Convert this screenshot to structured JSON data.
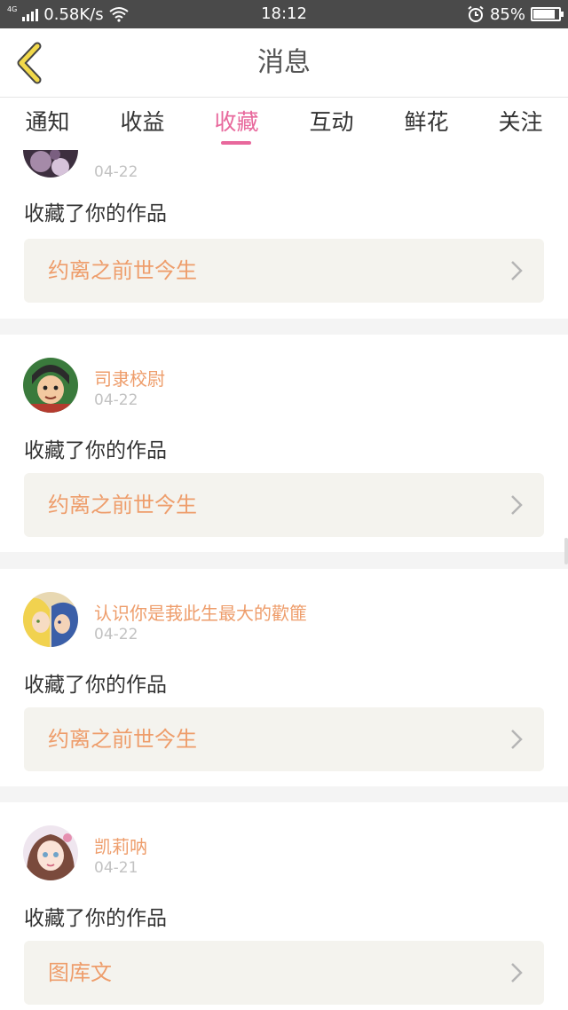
{
  "status_bar": {
    "network": "4G",
    "speed": "0.58K/s",
    "time": "18:12",
    "battery": "85%",
    "battery_level": 0.85
  },
  "header": {
    "title": "消息",
    "back_icon": "chevron-left-icon"
  },
  "tabs": [
    {
      "label": "通知"
    },
    {
      "label": "收益"
    },
    {
      "label": "收藏",
      "active": true
    },
    {
      "label": "互动"
    },
    {
      "label": "鲜花"
    },
    {
      "label": "关注"
    }
  ],
  "messages": [
    {
      "user": "",
      "date": "04-22",
      "text": "收藏了你的作品",
      "work": "约离之前世今生"
    },
    {
      "user": "司隶校尉",
      "date": "04-22",
      "text": "收藏了你的作品",
      "work": "约离之前世今生"
    },
    {
      "user": "认识你是莪此生最大的歡篚",
      "date": "04-22",
      "text": "收藏了你的作品",
      "work": "约离之前世今生"
    },
    {
      "user": "凯莉呐",
      "date": "04-21",
      "text": "收藏了你的作品",
      "work": "图库文"
    }
  ],
  "colors": {
    "accent_pink": "#e8689c",
    "username_orange": "#ee9d6b",
    "back_arrow_yellow": "#f2d94a",
    "link_bg": "#f4f3ee"
  }
}
